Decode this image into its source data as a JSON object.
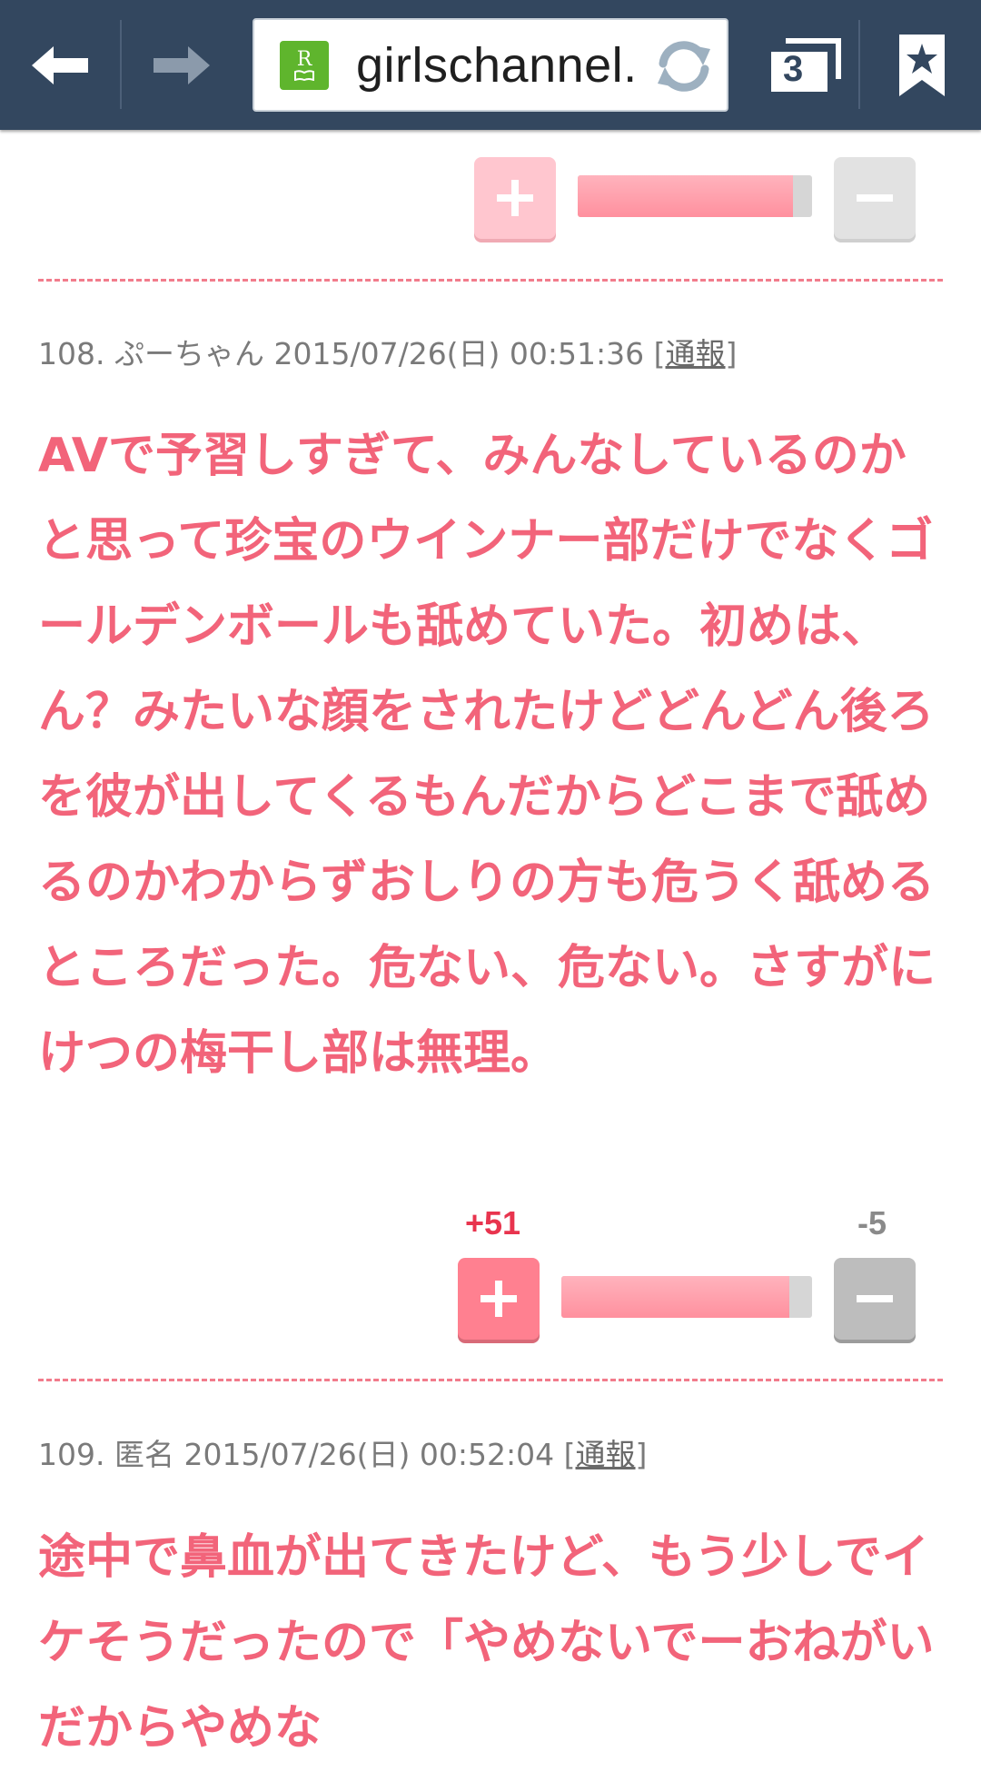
{
  "browser": {
    "url": "girlschannel.",
    "tab_count": "3",
    "favicon_letter": "R",
    "toolbar_color": "#33475f"
  },
  "comments": [
    {
      "vote_plus": "",
      "vote_minus": "",
      "ratio": 0.92
    },
    {
      "number": "108.",
      "name": "ぷーちゃん",
      "datetime": "2015/07/26(日) 00:51:36",
      "report_label": "通報",
      "text": "AVで予習しすぎて、みんなしているのかと思って珍宝のウインナー部だけでなくゴールデンボールも舐めていた。初めは、ん？みたいな顔をされたけどどんどん後ろを彼が出してくるもんだからどこまで舐めるのかわからずおしりの方も危うく舐めるところだった。危ない、危ない。さすがにけつの梅干し部は無理。",
      "vote_plus": "+51",
      "vote_minus": "-5",
      "ratio": 0.91
    },
    {
      "number": "109.",
      "name": "匿名",
      "datetime": "2015/07/26(日) 00:52:04",
      "report_label": "通報",
      "text": "途中で鼻血が出てきたけど、もう少しでイケそうだったので「やめないでーおねがいだからやめな"
    }
  ],
  "icons": {
    "back": "arrow-left-icon",
    "forward": "arrow-right-icon",
    "reload": "reload-icon",
    "tabs": "tabs-icon",
    "bookmark": "bookmark-star-icon",
    "plus": "plus-icon",
    "minus": "minus-icon"
  },
  "colors": {
    "accent_pink": "#f2647a",
    "plus_count": "#e8344e"
  }
}
